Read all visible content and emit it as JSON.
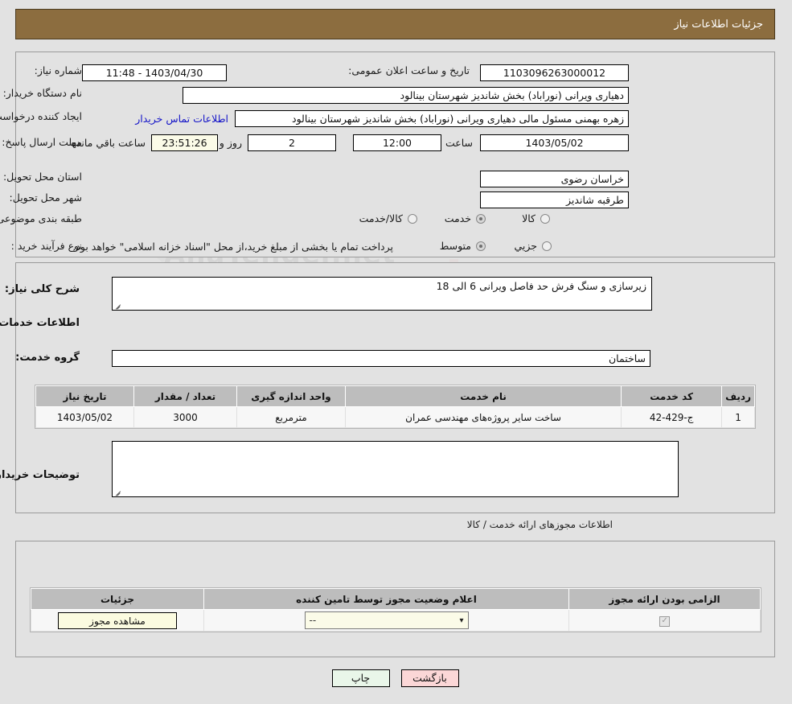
{
  "header": {
    "title": "جزئیات اطلاعات نیاز"
  },
  "form": {
    "need_number_label": "شماره نیاز:",
    "need_number_value": "1103096263000012",
    "announce_datetime_label": "تاریخ و ساعت اعلان عمومی:",
    "announce_datetime_value": "1403/04/30 - 11:48",
    "buyer_org_label": "نام دستگاه خریدار:",
    "buyer_org_value": "دهیاری ویرانی (نوراباد) بخش شاندیز شهرستان بینالود",
    "creator_label": "ایجاد کننده درخواست:",
    "creator_value": "زهره بهمنی مسئول مالی دهیاری ویرانی (نوراباد) بخش شاندیز شهرستان بینالود",
    "buyer_contact_link": "اطلاعات تماس خریدار",
    "deadline_label": "مهلت ارسال پاسخ: تا تاریخ:",
    "deadline_date": "1403/05/02",
    "time_label": "ساعت",
    "deadline_time": "12:00",
    "days_value": "2",
    "days_label": "روز و",
    "countdown_value": "23:51:26",
    "countdown_label": "ساعت باقي مانده",
    "province_label": "استان محل تحویل:",
    "province_value": "خراسان رضوی",
    "city_label": "شهر محل تحویل:",
    "city_value": "طرقبه شاندیز",
    "category_label": "طبقه بندی موضوعی:",
    "category_options": [
      "کالا",
      "خدمت",
      "کالا/خدمت"
    ],
    "category_selected": "خدمت",
    "process_label": "نوع فرآیند خرید :",
    "process_options": [
      "جزیي",
      "متوسط"
    ],
    "process_selected": "متوسط",
    "payment_note": "پرداخت تمام یا بخشی از مبلغ خرید،از محل \"اسناد خزانه اسلامی\" خواهد بود."
  },
  "need": {
    "general_desc_label": "شرح کلی نیاز:",
    "general_desc_value": "زیرسازی و سنگ فرش حد فاصل ویرانی 6 الی 18",
    "services_heading": "اطلاعات خدمات مورد نیاز",
    "service_group_label": "گروه خدمت:",
    "service_group_value": "ساختمان",
    "buyer_notes_label": "توضیحات خریدار:",
    "buyer_notes_value": ""
  },
  "services_table": {
    "columns": [
      "ردیف",
      "کد خدمت",
      "نام خدمت",
      "واحد اندازه گیری",
      "تعداد / مقدار",
      "تاریخ نیاز"
    ],
    "rows": [
      {
        "row_no": "1",
        "service_code": "ج-429-42",
        "service_name": "ساخت سایر پروژه‌های مهندسی عمران",
        "unit": "مترمربع",
        "quantity": "3000",
        "need_date": "1403/05/02"
      }
    ]
  },
  "permits": {
    "heading": "اطلاعات مجوزهای ارائه خدمت / کالا",
    "columns": [
      "الزامی بودن ارائه مجوز",
      "اعلام وضعیت مجوز توسط تامین کننده",
      "جزئیات"
    ],
    "rows": [
      {
        "required_checked": true,
        "status_value": "--",
        "details_button": "مشاهده مجوز"
      }
    ]
  },
  "footer": {
    "print_label": "چاپ",
    "back_label": "بازگشت"
  },
  "colors": {
    "title_bar": "#8c6d3f",
    "page_bg": "#e2e2e2",
    "link": "#1414c8",
    "table_header": "#bdbdbd",
    "cream_field": "#fbfbe8",
    "print_btn": "#e9f6e9",
    "back_btn": "#fbd7d7"
  },
  "watermark": {
    "text": "AnaTender.net"
  }
}
